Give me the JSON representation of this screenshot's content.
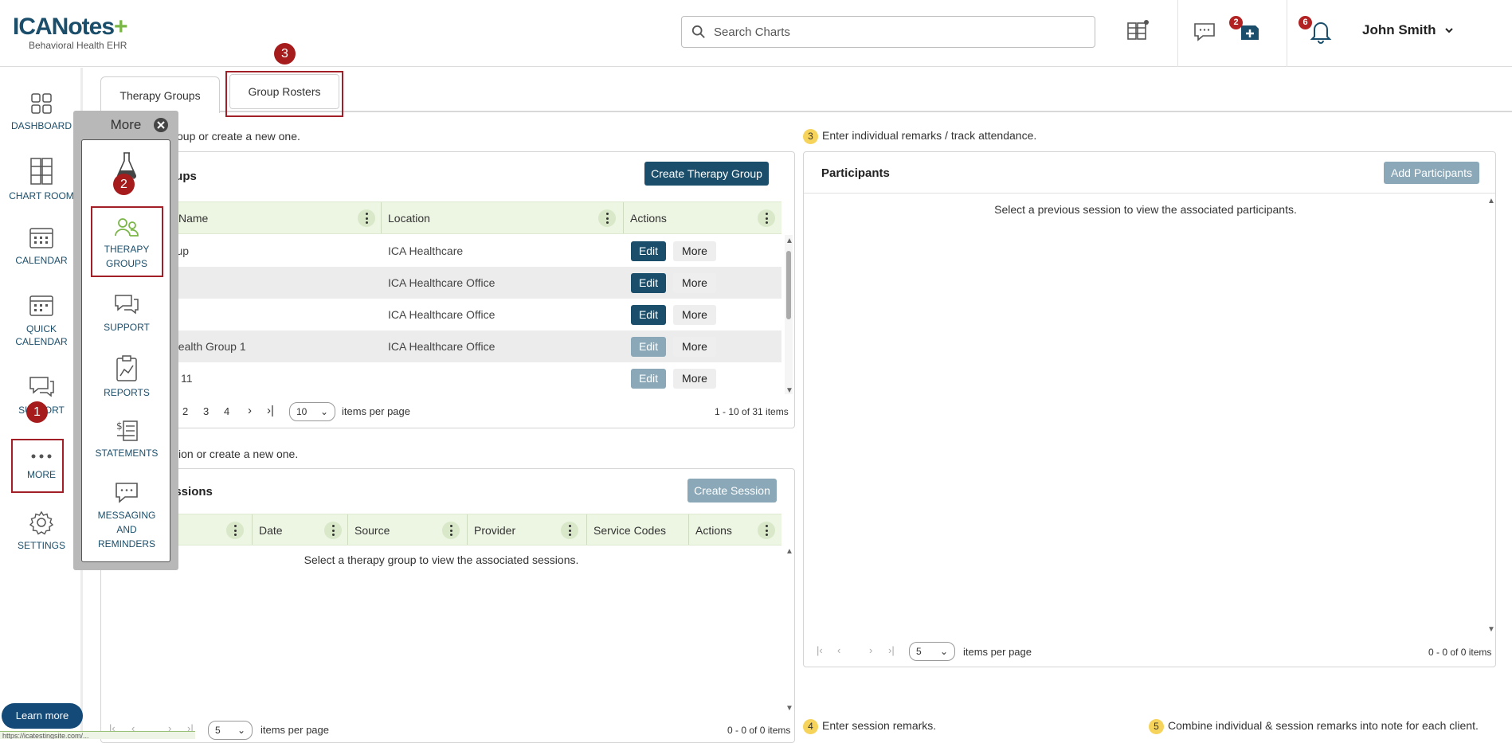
{
  "header": {
    "logo_text": "ICANotes",
    "logo_tagline": "Behavioral Health EHR",
    "search_placeholder": "Search Charts",
    "badge_tasks": "2",
    "badge_notifications": "6",
    "user_name": "John Smith"
  },
  "leftnav": {
    "items": [
      {
        "label": "DASHBOARD"
      },
      {
        "label": "CHART ROOM"
      },
      {
        "label": "CALENDAR"
      },
      {
        "label": "QUICK CALENDAR"
      },
      {
        "label": "SUPPORT"
      },
      {
        "label": "MORE"
      },
      {
        "label": "SETTINGS"
      }
    ],
    "learn_more": "Learn more"
  },
  "more_popup": {
    "title": "More",
    "items": [
      {
        "label": ""
      },
      {
        "label": "THERAPY GROUPS"
      },
      {
        "label": "SUPPORT"
      },
      {
        "label": "REPORTS"
      },
      {
        "label": "STATEMENTS"
      },
      {
        "label": "MESSAGING AND REMINDERS"
      }
    ]
  },
  "steps": {
    "s1": "1",
    "s2": "2",
    "s3": "3"
  },
  "tabs": [
    {
      "label": "Therapy Groups"
    },
    {
      "label": "Group Rosters"
    }
  ],
  "groups_panel": {
    "hint": "oup or create a new one.",
    "title": "oups",
    "create_button": "Create Therapy Group",
    "columns": [
      "Name",
      "Location",
      "Actions"
    ],
    "rows": [
      {
        "name": "roup",
        "location": "ICA Healthcare",
        "edit": "Edit",
        "more": "More"
      },
      {
        "name": "",
        "location": "ICA Healthcare Office",
        "edit": "Edit",
        "more": "More"
      },
      {
        "name": "",
        "location": "ICA Healthcare Office",
        "edit": "Edit",
        "more": "More"
      },
      {
        "name": "l health Group 1",
        "location": "ICA Healthcare Office",
        "edit": "Edit",
        "more": "More"
      },
      {
        "name": "11",
        "location": "",
        "edit": "Edit",
        "more": "More"
      }
    ],
    "pages": [
      "2",
      "3",
      "4"
    ],
    "page_size": "10",
    "items_per_page": "items per page",
    "range": "1 - 10 of 31 items"
  },
  "sessions_panel": {
    "hint": "ssion or create a new one.",
    "title": "essions",
    "create_button": "Create Session",
    "columns": [
      "Date",
      "Source",
      "Provider",
      "Service Codes",
      "Actions"
    ],
    "empty": "Select a therapy group to view the associated sessions.",
    "page_size": "5",
    "items_per_page": "items per page",
    "range": "0 - 0 of 0 items"
  },
  "participants_panel": {
    "step_num": "3",
    "hint": "Enter individual remarks / track attendance.",
    "title": "Participants",
    "add_button": "Add Participants",
    "empty": "Select a previous session to view the associated participants.",
    "page_size": "5",
    "items_per_page": "items per page",
    "range": "0 - 0 of 0 items"
  },
  "footer_hints": {
    "step4_num": "4",
    "step4": "Enter session remarks.",
    "step5_num": "5",
    "step5": "Combine individual & session remarks into note for each client."
  },
  "status_url": "https://icatestingsite.com/..."
}
